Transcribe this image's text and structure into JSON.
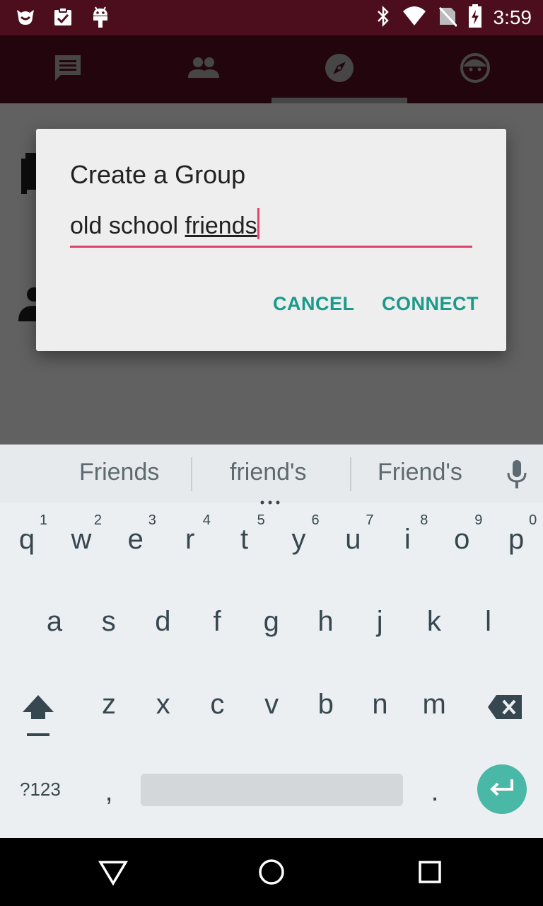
{
  "status_bar": {
    "time": "3:59",
    "left_icons": [
      "cat-notification-icon",
      "clipboard-check-icon",
      "android-debug-icon"
    ],
    "right_icons": [
      "bluetooth-icon",
      "wifi-icon",
      "no-sim-icon",
      "battery-charging-icon"
    ]
  },
  "tabs": [
    {
      "icon": "chat-icon",
      "selected": false
    },
    {
      "icon": "people-icon",
      "selected": false
    },
    {
      "icon": "compass-icon",
      "selected": true
    },
    {
      "icon": "face-icon",
      "selected": false
    }
  ],
  "dialog": {
    "title": "Create a Group",
    "input_text_plain": "old school ",
    "input_text_composing": "friends",
    "cancel_label": "CANCEL",
    "connect_label": "CONNECT"
  },
  "keyboard": {
    "suggestions": [
      "Friends",
      "friend's",
      "Friend's"
    ],
    "row1": [
      "q",
      "w",
      "e",
      "r",
      "t",
      "y",
      "u",
      "i",
      "o",
      "p"
    ],
    "row1_hints": [
      "1",
      "2",
      "3",
      "4",
      "5",
      "6",
      "7",
      "8",
      "9",
      "0"
    ],
    "row2": [
      "a",
      "s",
      "d",
      "f",
      "g",
      "h",
      "j",
      "k",
      "l"
    ],
    "row3": [
      "z",
      "x",
      "c",
      "v",
      "b",
      "n",
      "m"
    ],
    "symbols_label": "?123",
    "comma": ",",
    "period": "."
  },
  "colors": {
    "status_bar": "#4c0d1d",
    "tab_bar": "#5e1024",
    "accent": "#e0436e",
    "button_text": "#1b9a8b",
    "enter_key": "#49b8a6"
  }
}
